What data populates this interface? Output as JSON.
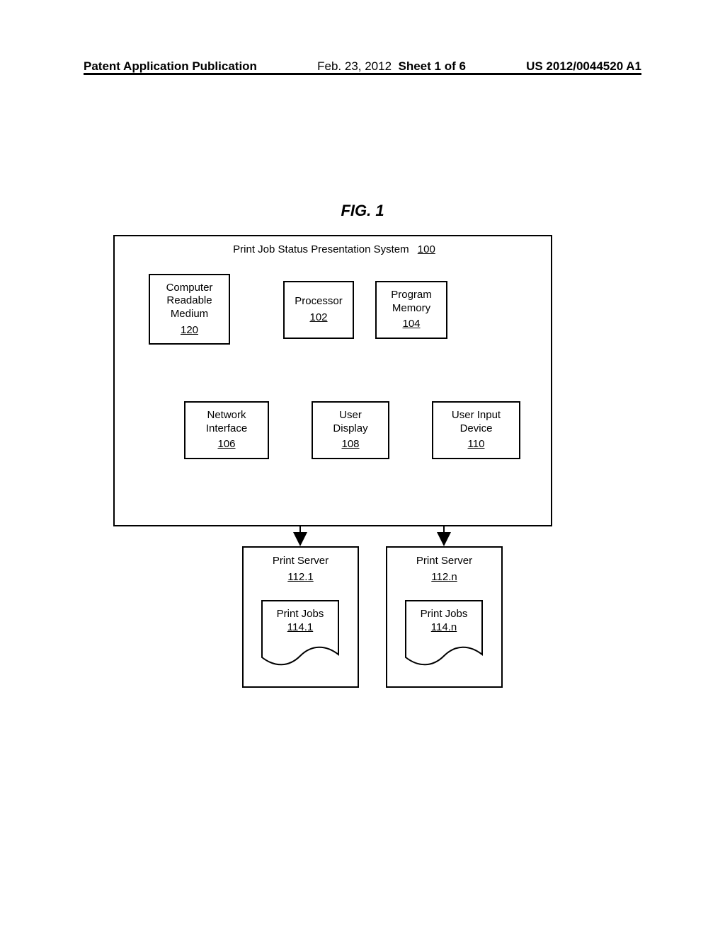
{
  "header": {
    "left": "Patent Application Publication",
    "date": "Feb. 23, 2012",
    "sheet_label": "Sheet 1 of 6",
    "pub_no": "US 2012/0044520 A1"
  },
  "figure_title": "FIG. 1",
  "system": {
    "title": "Print Job Status Presentation System",
    "ref": "100"
  },
  "blocks": {
    "crm": {
      "label_l1": "Computer",
      "label_l2": "Readable",
      "label_l3": "Medium",
      "ref": "120"
    },
    "processor": {
      "label": "Processor",
      "ref": "102"
    },
    "memory": {
      "label_l1": "Program",
      "label_l2": "Memory",
      "ref": "104"
    },
    "nif": {
      "label_l1": "Network",
      "label_l2": "Interface",
      "ref": "106"
    },
    "display": {
      "label_l1": "User",
      "label_l2": "Display",
      "ref": "108"
    },
    "input": {
      "label_l1": "User Input",
      "label_l2": "Device",
      "ref": "110"
    }
  },
  "servers": [
    {
      "label": "Print Server",
      "ref": "112.1",
      "jobs_label": "Print Jobs",
      "jobs_ref": "114.1"
    },
    {
      "label": "Print Server",
      "ref": "112.n",
      "jobs_label": "Print Jobs",
      "jobs_ref": "114.n"
    }
  ]
}
